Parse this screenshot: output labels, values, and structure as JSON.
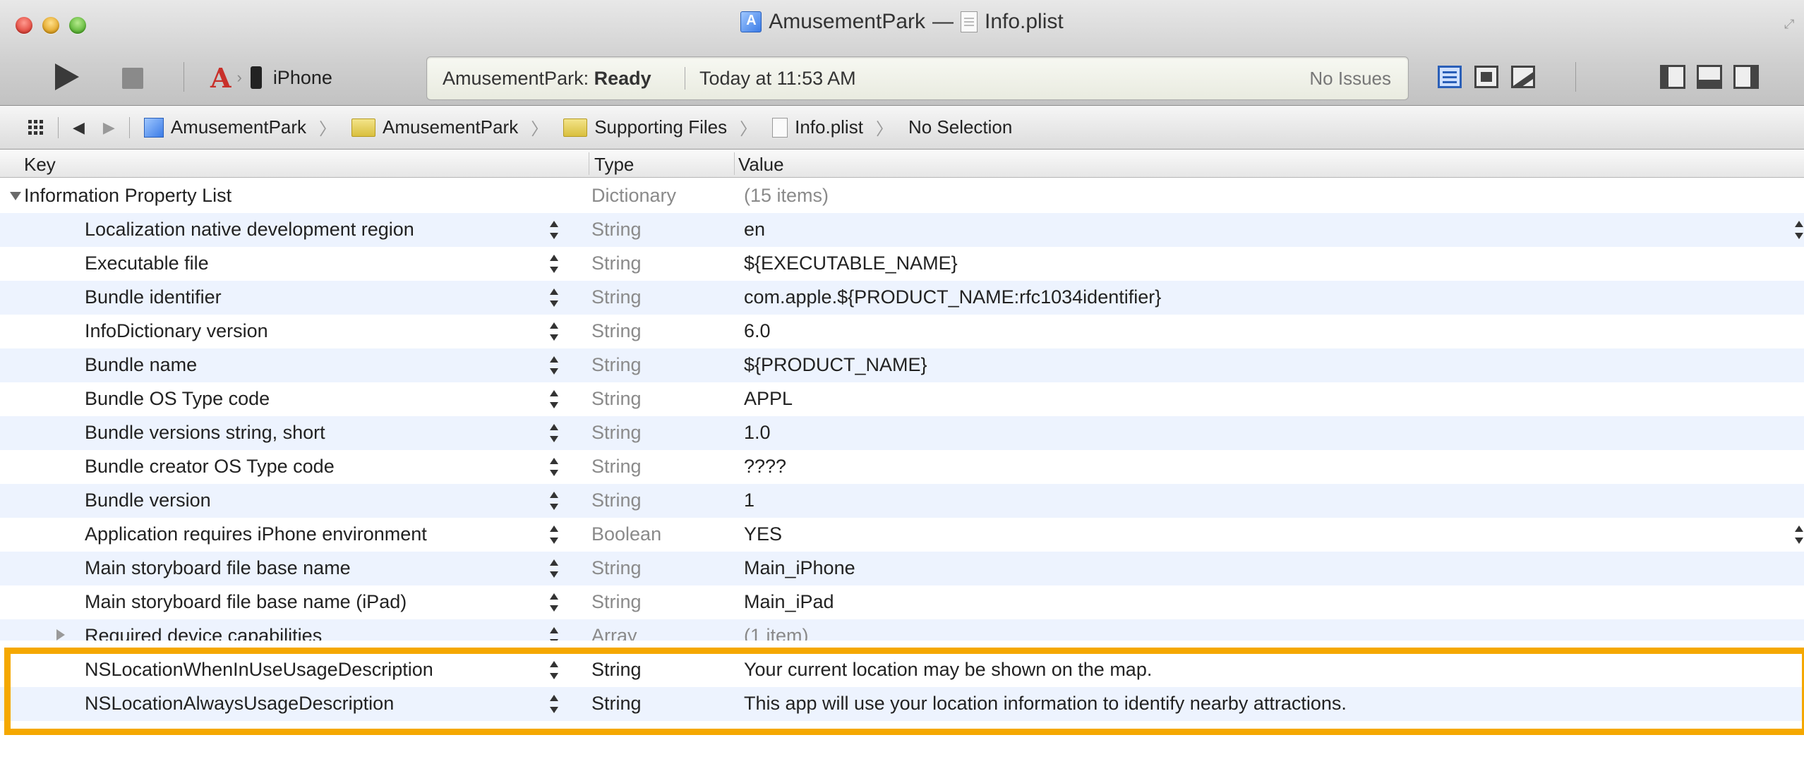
{
  "window": {
    "title_project": "AmusementPark",
    "title_sep": "—",
    "title_file": "Info.plist"
  },
  "toolbar": {
    "scheme_device": "iPhone",
    "status_project": "AmusementPark:",
    "status_state": "Ready",
    "status_time": "Today at 11:53 AM",
    "issues": "No Issues"
  },
  "jumpbar": {
    "crumbs": [
      "AmusementPark",
      "AmusementPark",
      "Supporting Files",
      "Info.plist",
      "No Selection"
    ]
  },
  "table": {
    "headers": {
      "key": "Key",
      "type": "Type",
      "value": "Value"
    },
    "root": {
      "key": "Information Property List",
      "type": "Dictionary",
      "value": "(15 items)"
    },
    "rows": [
      {
        "key": "Localization native development region",
        "type": "String",
        "value": "en"
      },
      {
        "key": "Executable file",
        "type": "String",
        "value": "${EXECUTABLE_NAME}"
      },
      {
        "key": "Bundle identifier",
        "type": "String",
        "value": "com.apple.${PRODUCT_NAME:rfc1034identifier}"
      },
      {
        "key": "InfoDictionary version",
        "type": "String",
        "value": "6.0"
      },
      {
        "key": "Bundle name",
        "type": "String",
        "value": "${PRODUCT_NAME}"
      },
      {
        "key": "Bundle OS Type code",
        "type": "String",
        "value": "APPL"
      },
      {
        "key": "Bundle versions string, short",
        "type": "String",
        "value": "1.0"
      },
      {
        "key": "Bundle creator OS Type code",
        "type": "String",
        "value": "????"
      },
      {
        "key": "Bundle version",
        "type": "String",
        "value": "1"
      },
      {
        "key": "Application requires iPhone environment",
        "type": "Boolean",
        "value": "YES"
      },
      {
        "key": "Main storyboard file base name",
        "type": "String",
        "value": "Main_iPhone"
      },
      {
        "key": "Main storyboard file base name (iPad)",
        "type": "String",
        "value": "Main_iPad"
      },
      {
        "key": "Required device capabilities",
        "type": "Array",
        "value": "(1 item)"
      },
      {
        "key": "NSLocationWhenInUseUsageDescription",
        "type": "String",
        "value": "Your current location may be shown on the map."
      },
      {
        "key": "NSLocationAlwaysUsageDescription",
        "type": "String",
        "value": "This app will use your location information to identify nearby attractions."
      }
    ]
  },
  "colors": {
    "highlight": "#f5a800",
    "alt_row": "#edf3fe"
  }
}
